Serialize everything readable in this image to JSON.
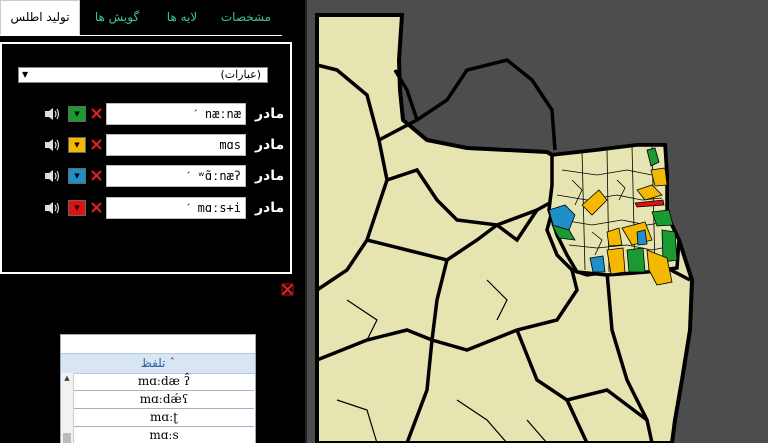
{
  "tabs": [
    {
      "label": "تولید اطلس",
      "active": true
    },
    {
      "label": "گویش ها",
      "active": false
    },
    {
      "label": "لایه ها",
      "active": false
    },
    {
      "label": "مشخصات",
      "active": false
    }
  ],
  "expression_select": {
    "value": "(عبارات)"
  },
  "rows": [
    {
      "word": "مادر",
      "token": "ˊ næːnæ",
      "color": "#1a9a30"
    },
    {
      "word": "مادر",
      "token": "mɑs",
      "color": "#f5b800"
    },
    {
      "word": "مادر",
      "token": "ˊ ʷɑ̃ːnæʔ",
      "color": "#1f8fc8"
    },
    {
      "word": "مادر",
      "token": "ˊ mɑːs+i",
      "color": "#e01010"
    }
  ],
  "pronunciation_list": {
    "header": "تلفظ ˆ",
    "items": [
      "mɑːdæ ʔ̂",
      "mɑːdǽʕ",
      "mɑːʈ",
      "mɑːs"
    ]
  },
  "map": {
    "background_color": "#4d4d4d",
    "land_color": "#e6e4b0",
    "highlight_colors": [
      "#1a9a30",
      "#f5b800",
      "#1f8fc8",
      "#e01010"
    ]
  }
}
